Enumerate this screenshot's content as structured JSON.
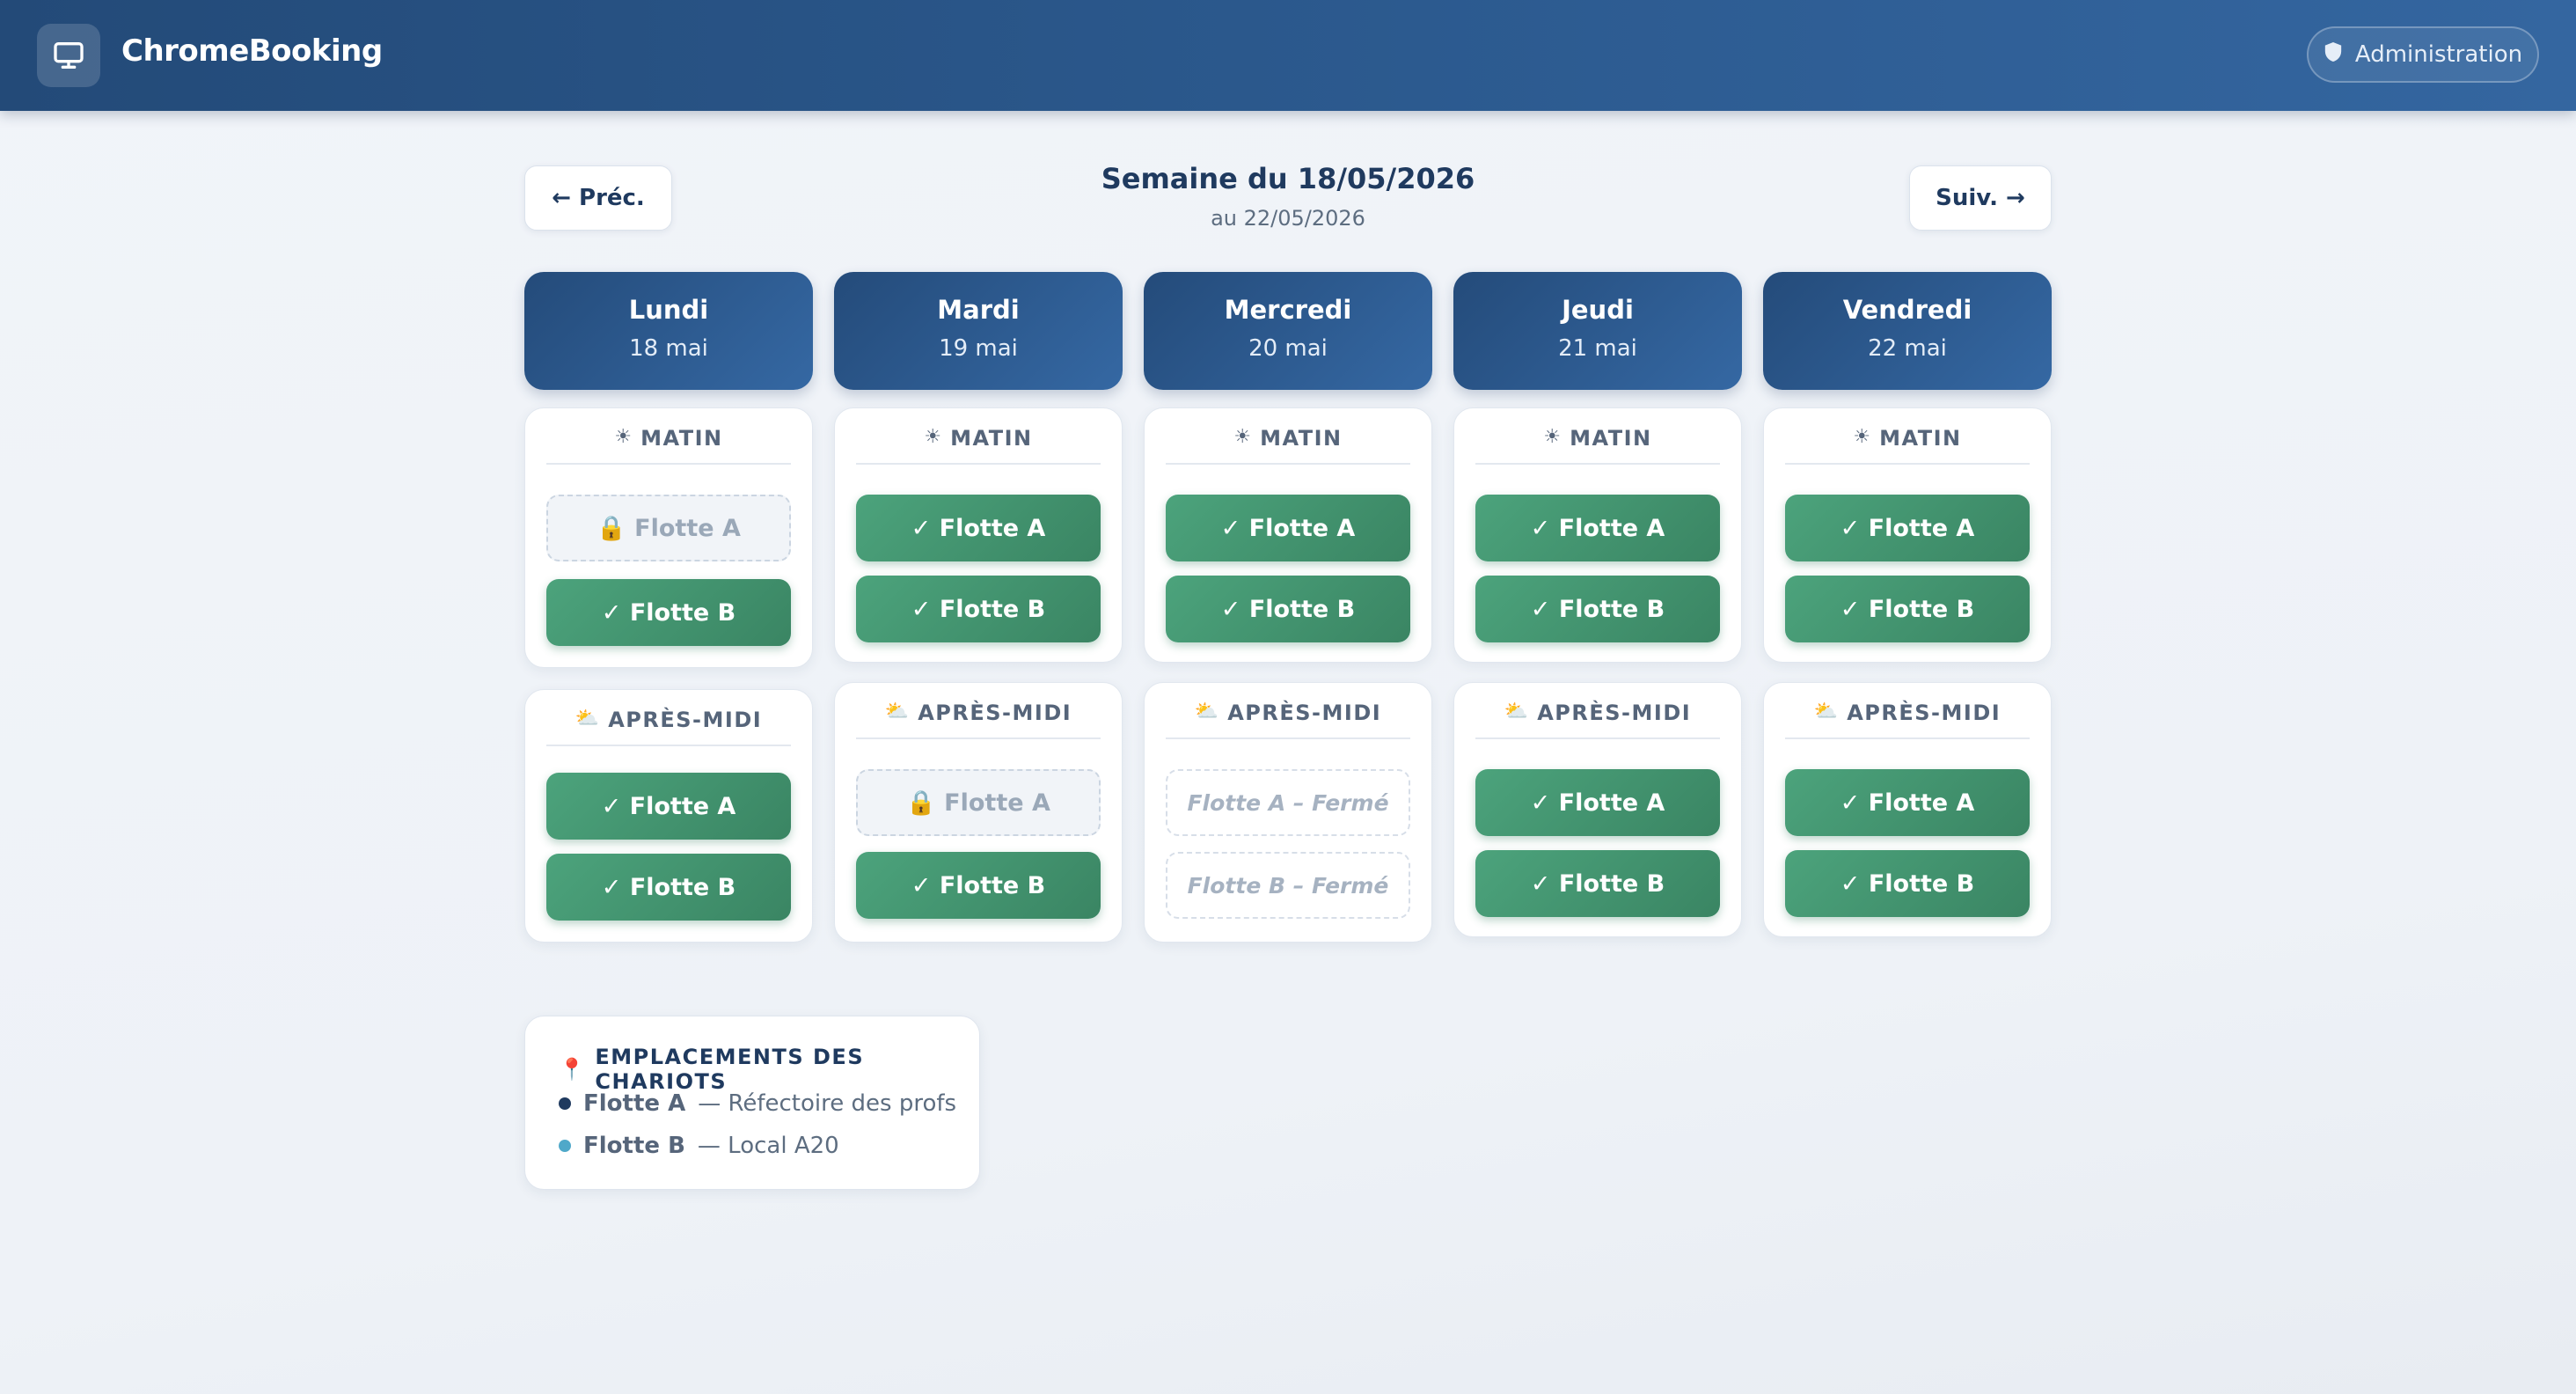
{
  "app": {
    "name": "ChromeBooking",
    "icon": "monitor-icon"
  },
  "header": {
    "admin_label": "Administration",
    "admin_icon": "shield-icon"
  },
  "week": {
    "prev_label": "← Préc.",
    "next_label": "Suiv. →",
    "title": "Semaine du 18/05/2026",
    "subtitle": "au 22/05/2026"
  },
  "days": [
    {
      "name": "Lundi",
      "date": "18 mai",
      "morning": {
        "label": "MATIN",
        "icon": "☀",
        "fleets": [
          {
            "text": "🔒 Flotte A",
            "state": "locked"
          },
          {
            "text": "✓ Flotte B",
            "state": "available"
          }
        ]
      },
      "afternoon": {
        "label": "APRÈS-MIDI",
        "icon": "⛅",
        "fleets": [
          {
            "text": "✓ Flotte A",
            "state": "available"
          },
          {
            "text": "✓ Flotte B",
            "state": "available"
          }
        ]
      }
    },
    {
      "name": "Mardi",
      "date": "19 mai",
      "morning": {
        "label": "MATIN",
        "icon": "☀",
        "fleets": [
          {
            "text": "✓ Flotte A",
            "state": "available"
          },
          {
            "text": "✓ Flotte B",
            "state": "available"
          }
        ]
      },
      "afternoon": {
        "label": "APRÈS-MIDI",
        "icon": "⛅",
        "fleets": [
          {
            "text": "🔒 Flotte A",
            "state": "locked"
          },
          {
            "text": "✓ Flotte B",
            "state": "available"
          }
        ]
      }
    },
    {
      "name": "Mercredi",
      "date": "20 mai",
      "morning": {
        "label": "MATIN",
        "icon": "☀",
        "fleets": [
          {
            "text": "✓ Flotte A",
            "state": "available"
          },
          {
            "text": "✓ Flotte B",
            "state": "available"
          }
        ]
      },
      "afternoon": {
        "label": "APRÈS-MIDI",
        "icon": "⛅",
        "fleets": [
          {
            "text": "Flotte A – Fermé",
            "state": "closed"
          },
          {
            "text": "Flotte B – Fermé",
            "state": "closed"
          }
        ]
      }
    },
    {
      "name": "Jeudi",
      "date": "21 mai",
      "morning": {
        "label": "MATIN",
        "icon": "☀",
        "fleets": [
          {
            "text": "✓ Flotte A",
            "state": "available"
          },
          {
            "text": "✓ Flotte B",
            "state": "available"
          }
        ]
      },
      "afternoon": {
        "label": "APRÈS-MIDI",
        "icon": "⛅",
        "fleets": [
          {
            "text": "✓ Flotte A",
            "state": "available"
          },
          {
            "text": "✓ Flotte B",
            "state": "available"
          }
        ]
      }
    },
    {
      "name": "Vendredi",
      "date": "22 mai",
      "morning": {
        "label": "MATIN",
        "icon": "☀",
        "fleets": [
          {
            "text": "✓ Flotte A",
            "state": "available"
          },
          {
            "text": "✓ Flotte B",
            "state": "available"
          }
        ]
      },
      "afternoon": {
        "label": "APRÈS-MIDI",
        "icon": "⛅",
        "fleets": [
          {
            "text": "✓ Flotte A",
            "state": "available"
          },
          {
            "text": "✓ Flotte B",
            "state": "available"
          }
        ]
      }
    }
  ],
  "legend": {
    "icon": "📍",
    "title": "EMPLACEMENTS DES CHARIOTS",
    "items": [
      {
        "fleet": "Flotte A",
        "location": "— Réfectoire des profs",
        "color": "#1f3a5f"
      },
      {
        "fleet": "Flotte B",
        "location": "— Local A20",
        "color": "#4fa8c9"
      }
    ]
  },
  "colors": {
    "available": "#3f8f6b",
    "header": "#2c5a8f",
    "accent": "#244b7a"
  }
}
